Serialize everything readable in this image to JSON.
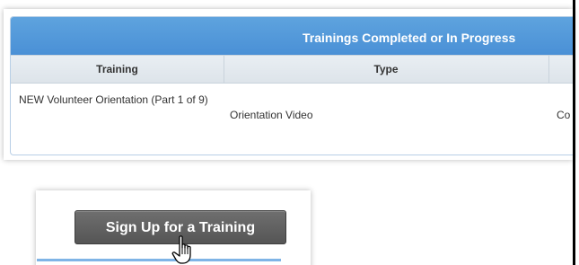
{
  "table": {
    "title": "Trainings Completed or In Progress",
    "columns": [
      "Training",
      "Type",
      ""
    ],
    "rows": [
      {
        "training": "NEW Volunteer Orientation (Part 1 of 9)",
        "type": "Orientation Video",
        "status_partial": "Co"
      }
    ]
  },
  "actions": {
    "signup_label": "Sign Up for a Training"
  },
  "colors": {
    "header_blue": "#4a90d6",
    "button_gray": "#5e5e5e",
    "accent_blue": "#7fb4e6"
  },
  "icons": {
    "cursor": "hand-pointer-icon"
  }
}
